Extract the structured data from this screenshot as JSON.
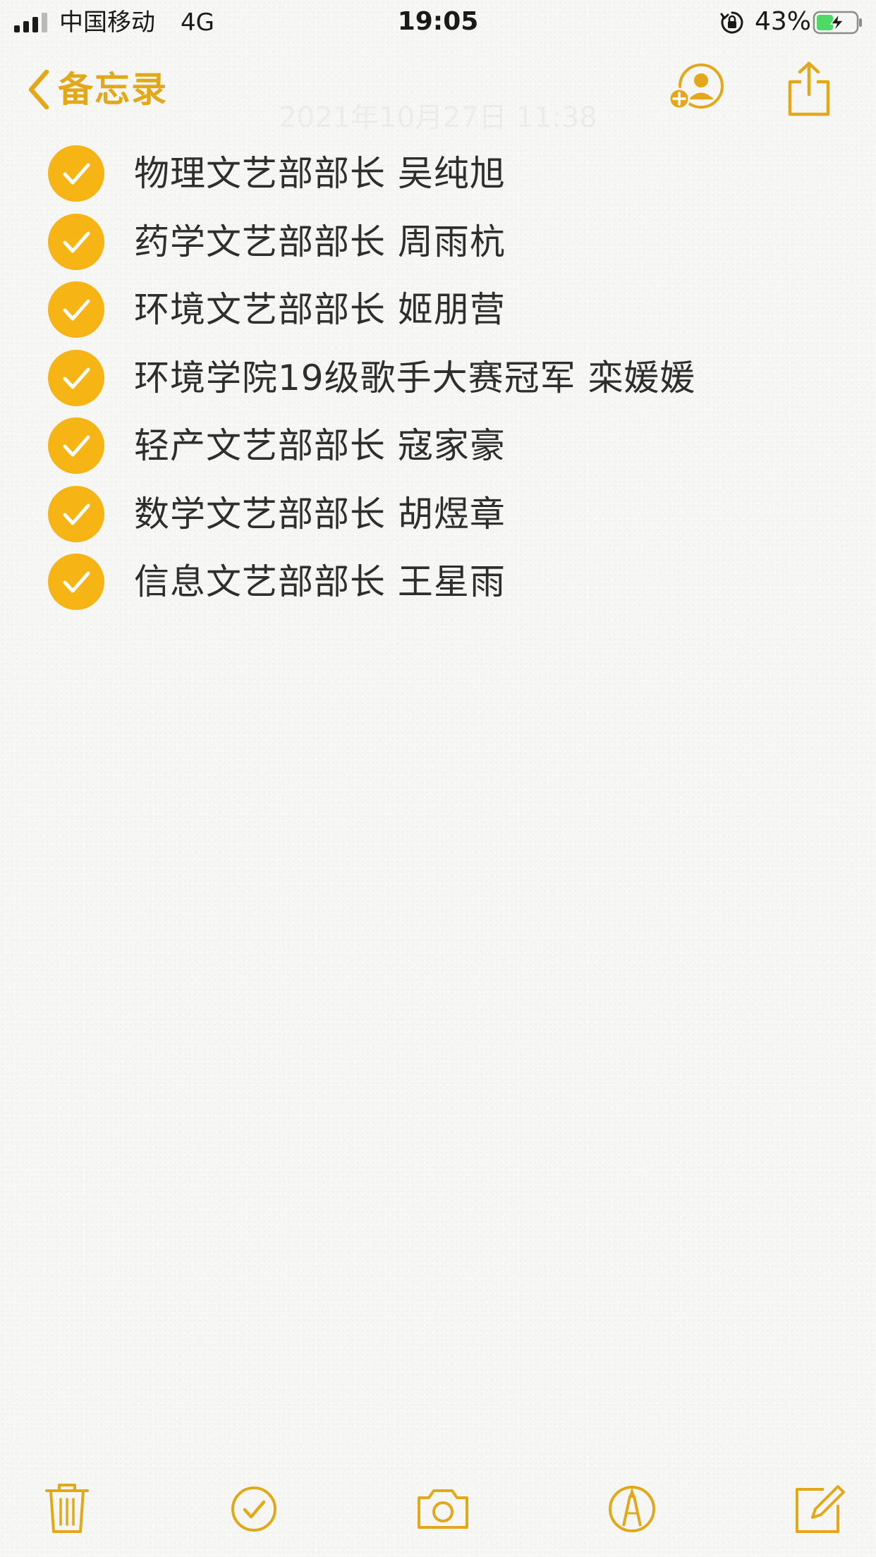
{
  "status_bar": {
    "carrier": "中国移动",
    "network": "4G",
    "time": "19:05",
    "battery_percent": "43%",
    "battery_level": 0.43,
    "charging": true,
    "signal_bars": 3,
    "signal_max": 4,
    "icons": {
      "signal": "signal-strength-icon",
      "orientation_lock": "orientation-lock-icon",
      "battery": "battery-charging-icon"
    }
  },
  "nav": {
    "back_label": "备忘录",
    "faded_date": "2021年10月27日 11:38",
    "icons": {
      "back": "chevron-left-icon",
      "add_person": "add-person-icon",
      "share": "share-icon"
    }
  },
  "checklist": {
    "items": [
      {
        "text": "物理文艺部部长 吴纯旭",
        "checked": true
      },
      {
        "text": "药学文艺部部长 周雨杭",
        "checked": true
      },
      {
        "text": "环境文艺部部长 姬朋营",
        "checked": true
      },
      {
        "text": "环境学院19级歌手大赛冠军 栾媛媛",
        "checked": true
      },
      {
        "text": "轻产文艺部部长 寇家豪",
        "checked": true
      },
      {
        "text": "数学文艺部部长 胡煜章",
        "checked": true
      },
      {
        "text": "信息文艺部部长 王星雨",
        "checked": true
      }
    ]
  },
  "toolbar": {
    "icons": [
      "trash-icon",
      "checklist-icon",
      "camera-icon",
      "markup-icon",
      "compose-icon"
    ]
  },
  "colors": {
    "accent": "#e3a81a",
    "check_fill": "#f7b515",
    "background": "#f6f6f5",
    "text": "#2e2e2e"
  }
}
